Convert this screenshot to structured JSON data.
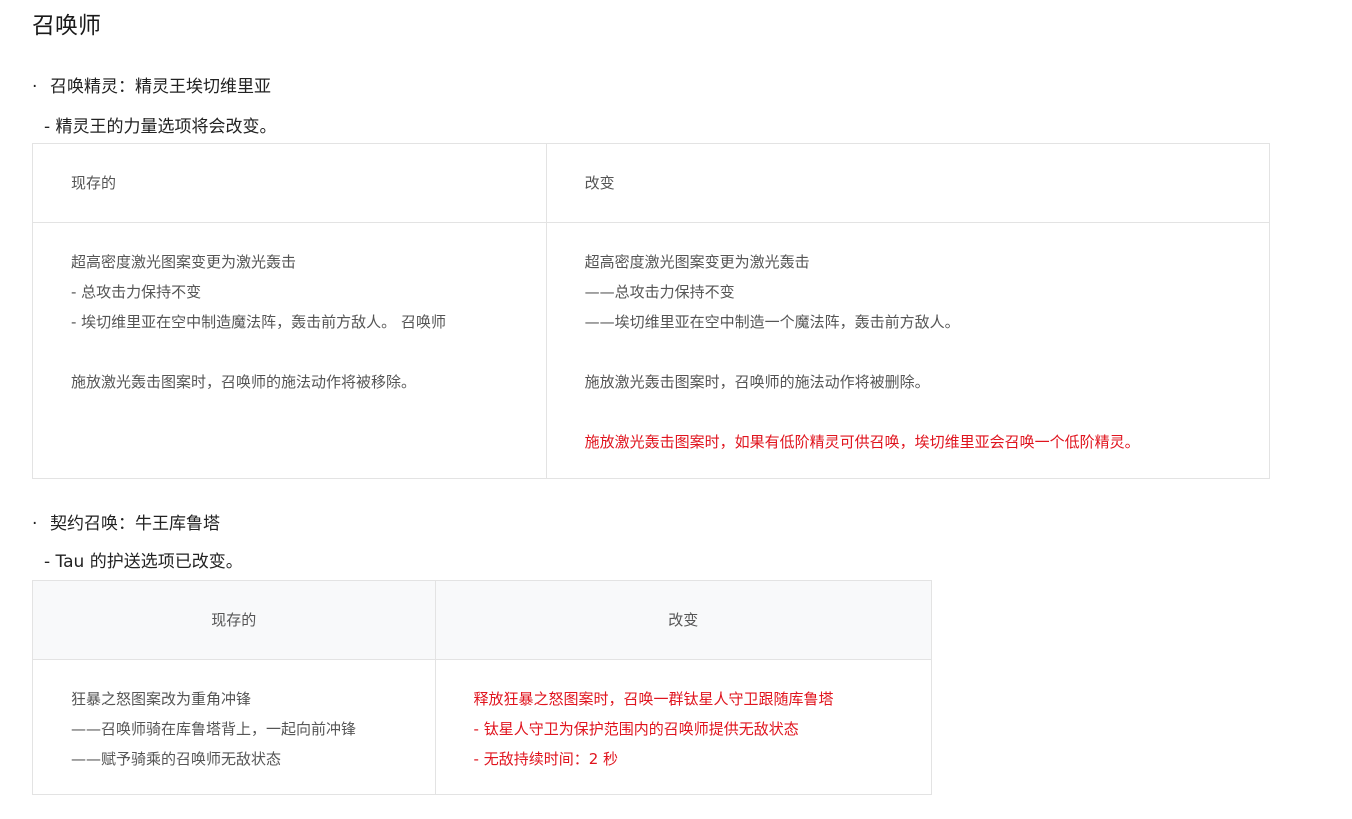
{
  "page_title": "召唤师",
  "sections": [
    {
      "bullet": "·",
      "heading": "召唤精灵：精灵王埃切维里亚",
      "subheading": "- 精灵王的力量选项将会改变。",
      "table": {
        "headers": [
          "现存的",
          "改变"
        ],
        "current_lines": [
          "超高密度激光图案变更为激光轰击",
          " - 总攻击力保持不变",
          " - 埃切维里亚在空中制造魔法阵，轰击前方敌人。 召唤师",
          "",
          "施放激光轰击图案时，召唤师的施法动作将被移除。"
        ],
        "changed_lines": [
          "超高密度激光图案变更为激光轰击",
          " ——总攻击力保持不变",
          " ——埃切维里亚在空中制造一个魔法阵，轰击前方敌人。",
          "",
          "施放激光轰击图案时，召唤师的施法动作将被删除。",
          ""
        ],
        "changed_highlight": "施放激光轰击图案时，如果有低阶精灵可供召唤，埃切维里亚会召唤一个低阶精灵。"
      }
    },
    {
      "bullet": "·",
      "heading": "契约召唤：牛王库鲁塔",
      "subheading": "- Tau 的护送选项已改变。",
      "table": {
        "headers": [
          "现存的",
          "改变"
        ],
        "current_lines": [
          "狂暴之怒图案改为重角冲锋",
          "——召唤师骑在库鲁塔背上，一起向前冲锋",
          "——赋予骑乘的召唤师无敌状态"
        ],
        "changed_lines": [
          "释放狂暴之怒图案时，召唤一群钛星人守卫跟随库鲁塔",
          " - 钛星人守卫为保护范围内的召唤师提供无敌状态",
          " - 无敌持续时间：2 秒"
        ]
      }
    }
  ],
  "colors": {
    "highlight": "#e0141e",
    "table_border": "#e3e3e3",
    "header_bg_table2": "#f8f9fa"
  }
}
